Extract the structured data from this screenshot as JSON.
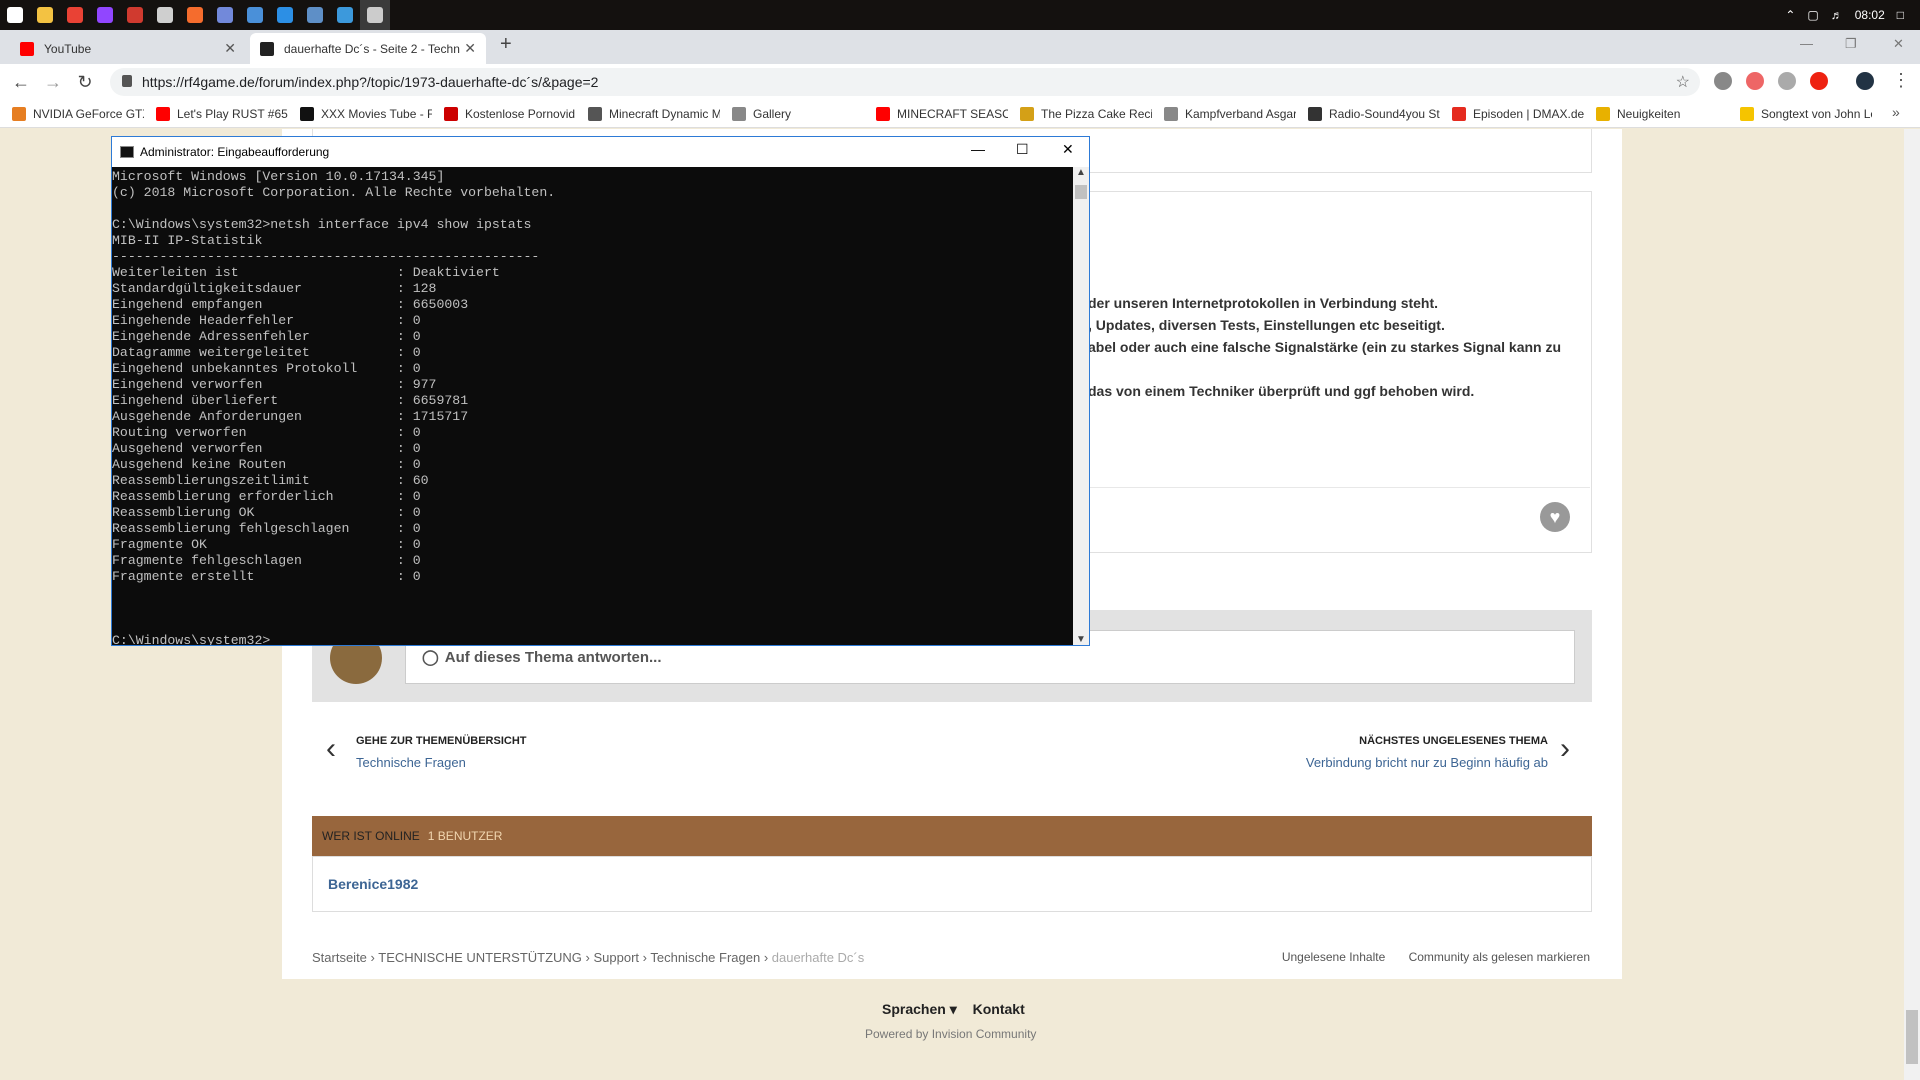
{
  "taskbar": {
    "icons": [
      {
        "name": "windows-start-icon",
        "color": "#ffffff"
      },
      {
        "name": "file-explorer-icon",
        "color": "#f3c242"
      },
      {
        "name": "chrome-icon",
        "color": "#e94235"
      },
      {
        "name": "twitch-icon",
        "color": "#9146ff"
      },
      {
        "name": "app-icon",
        "color": "#d03a2f"
      },
      {
        "name": "tool-icon",
        "color": "#cfcfcf"
      },
      {
        "name": "origin-icon",
        "color": "#f56c2d"
      },
      {
        "name": "discord-icon",
        "color": "#7289da"
      },
      {
        "name": "uplay-icon",
        "color": "#4a90d9"
      },
      {
        "name": "battlenet-icon",
        "color": "#2c8fe5"
      },
      {
        "name": "steam-icon",
        "color": "#5e8fc7"
      },
      {
        "name": "vscode-icon",
        "color": "#3c99dc"
      },
      {
        "name": "cmd-icon",
        "color": "#cccccc"
      }
    ],
    "clock": "08:02"
  },
  "browser": {
    "tabs": [
      {
        "title": "YouTube",
        "favicon_color": "#ff0000"
      },
      {
        "title": "dauerhafte Dc´s - Seite 2 - Techn",
        "favicon_color": "#222222"
      }
    ],
    "url": "https://rf4game.de/forum/index.php?/topic/1973-dauerhafte-dc´s/&page=2",
    "bookmarks": [
      {
        "label": "NVIDIA GeForce GTX",
        "color": "#e67e22"
      },
      {
        "label": "Let's Play RUST #65 -",
        "color": "#ff0000"
      },
      {
        "label": "XXX Movies Tube - Fr",
        "color": "#111111"
      },
      {
        "label": "Kostenlose Pornovid",
        "color": "#cc0000"
      },
      {
        "label": "Minecraft Dynamic M",
        "color": "#555555"
      },
      {
        "label": "Gallery",
        "color": "#888888"
      },
      {
        "label": "MINECRAFT SEASON",
        "color": "#ff0000"
      },
      {
        "label": "The Pizza Cake Recip",
        "color": "#d4a017"
      },
      {
        "label": "Kampfverband Asgar",
        "color": "#888888"
      },
      {
        "label": "Radio-Sound4you St",
        "color": "#333333"
      },
      {
        "label": "Episoden | DMAX.de",
        "color": "#e52b1f"
      },
      {
        "label": "Neuigkeiten",
        "color": "#e8b100"
      },
      {
        "label": "Songtext von John Le",
        "color": "#f5c400"
      }
    ]
  },
  "post": {
    "lines": [
      "der unseren Internetprotokollen in Verbindung steht.",
      ", Updates, diversen Tests, Einstellungen etc beseitigt.",
      "abel oder auch eine falsche Signalstärke (ein zu starkes Signal kann zu",
      "das von einem Techniker überprüft und ggf behoben wird."
    ],
    "reply_placeholder": "Auf dieses Thema antworten..."
  },
  "topic_nav": {
    "prev_label": "GEHE ZUR THEMENÜBERSICHT",
    "prev_title": "Technische Fragen",
    "next_label": "NÄCHSTES UNGELESENES THEMA",
    "next_title": "Verbindung bricht nur zu Beginn häufig ab"
  },
  "online": {
    "heading": "WER IST ONLINE",
    "count": "1 BENUTZER",
    "user": "Berenice1982"
  },
  "breadcrumb": [
    "Startseite",
    "TECHNISCHE UNTERSTÜTZUNG",
    "Support",
    "Technische Fragen",
    "dauerhafte Dc´s"
  ],
  "footer": {
    "unread": "Ungelesene Inhalte",
    "mark_read": "Community als gelesen markieren",
    "language": "Sprachen",
    "contact": "Kontakt",
    "powered": "Powered by Invision Community"
  },
  "cmd": {
    "title": "Administrator: Eingabeaufforderung",
    "lines": [
      "Microsoft Windows [Version 10.0.17134.345]",
      "(c) 2018 Microsoft Corporation. Alle Rechte vorbehalten.",
      "",
      "C:\\Windows\\system32>netsh interface ipv4 show ipstats",
      "MIB-II IP-Statistik",
      "------------------------------------------------------",
      "Weiterleiten ist                    : Deaktiviert",
      "Standardgültigkeitsdauer            : 128",
      "Eingehend empfangen                 : 6650003",
      "Eingehende Headerfehler             : 0",
      "Eingehende Adressenfehler           : 0",
      "Datagramme weitergeleitet           : 0",
      "Eingehend unbekanntes Protokoll     : 0",
      "Eingehend verworfen                 : 977",
      "Eingehend überliefert               : 6659781",
      "Ausgehende Anforderungen            : 1715717",
      "Routing verworfen                   : 0",
      "Ausgehend verworfen                 : 0",
      "Ausgehend keine Routen              : 0",
      "Reassemblierungszeitlimit           : 60",
      "Reassemblierung erforderlich        : 0",
      "Reassemblierung OK                  : 0",
      "Reassemblierung fehlgeschlagen      : 0",
      "Fragmente OK                        : 0",
      "Fragmente fehlgeschlagen            : 0",
      "Fragmente erstellt                  : 0",
      "",
      "",
      "",
      "C:\\Windows\\system32>"
    ]
  }
}
